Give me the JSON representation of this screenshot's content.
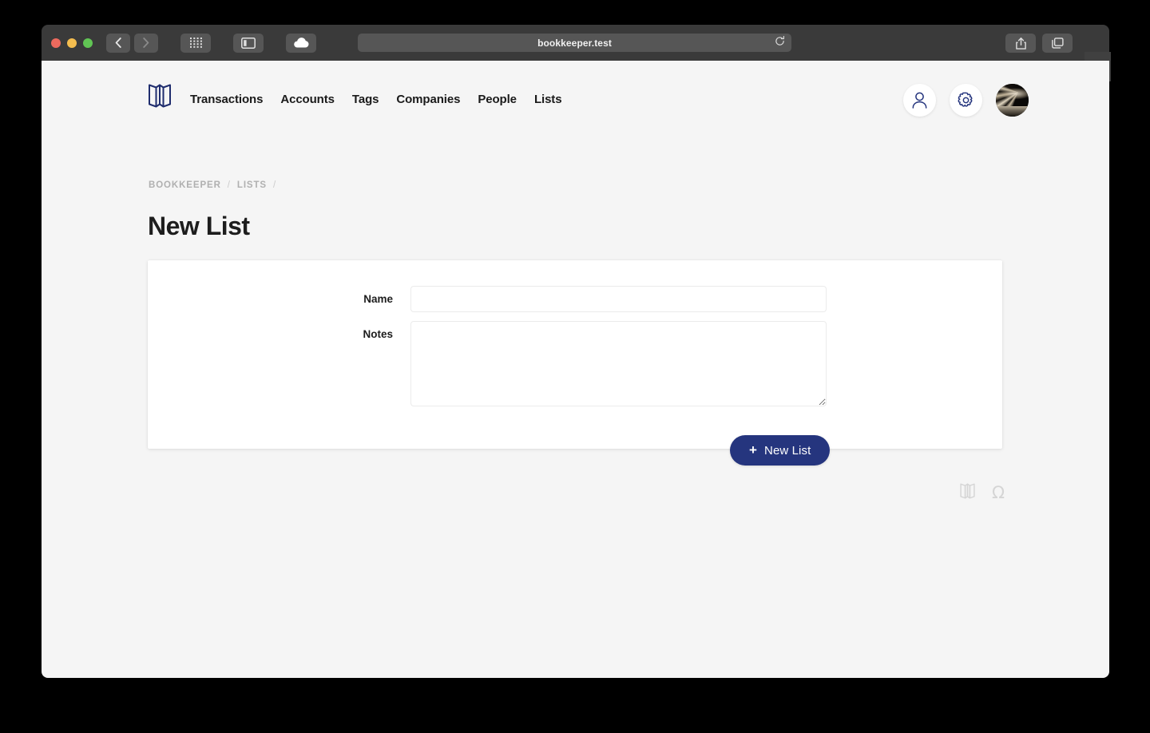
{
  "browser": {
    "url": "bookkeeper.test",
    "back_label": "Back",
    "forward_label": "Forward",
    "tabs_overview_label": "Tab Overview",
    "sidebar_label": "Show Sidebar",
    "icloud_label": "iCloud Tabs",
    "reload_label": "Reload",
    "share_label": "Share",
    "tab_switcher_label": "Tab Switcher",
    "newtab_label": "+"
  },
  "nav": {
    "logo_label": "Bookkeeper",
    "links": [
      {
        "label": "Transactions"
      },
      {
        "label": "Accounts"
      },
      {
        "label": "Tags"
      },
      {
        "label": "Companies"
      },
      {
        "label": "People"
      },
      {
        "label": "Lists"
      }
    ],
    "account_label": "Account",
    "settings_label": "Settings",
    "avatar_label": "User Avatar"
  },
  "breadcrumb": {
    "root": "BOOKKEEPER",
    "sep1": "/",
    "section": "LISTS",
    "sep2": "/"
  },
  "page": {
    "title": "New List"
  },
  "form": {
    "name_label": "Name",
    "name_value": "",
    "name_placeholder": "",
    "notes_label": "Notes",
    "notes_value": "",
    "notes_placeholder": "",
    "submit_label": "New List",
    "submit_icon": "+"
  },
  "footer": {
    "book_icon_label": "Bookkeeper",
    "omega_symbol": "Ω"
  },
  "colors": {
    "brand_navy": "#25357e",
    "page_bg": "#f5f5f5",
    "card_bg": "#ffffff",
    "text_dark": "#1d1d1d",
    "muted": "#b0b0b0"
  }
}
